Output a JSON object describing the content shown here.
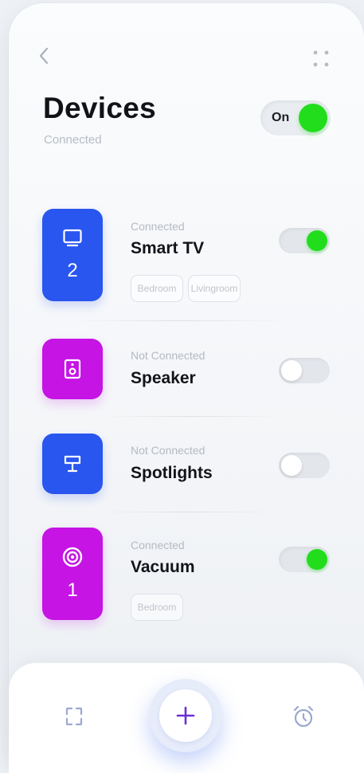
{
  "header": {
    "back_icon": "chevron-left-icon",
    "menu_icon": "dots-grid-icon",
    "title": "Devices",
    "subtitle": "Connected",
    "master_toggle": {
      "label": "On",
      "state": "on"
    }
  },
  "devices": [
    {
      "name": "Smart TV",
      "status": "Connected",
      "icon": "tv-icon",
      "tile_color": "#2956ef",
      "count": "2",
      "tags": [
        "Bedroom",
        "Livingroom"
      ],
      "enabled": true
    },
    {
      "name": "Speaker",
      "status": "Not Connected",
      "icon": "speaker-icon",
      "tile_color": "#c514e4",
      "count": "",
      "tags": [],
      "enabled": false
    },
    {
      "name": "Spotlights",
      "status": "Not Connected",
      "icon": "lamp-icon",
      "tile_color": "#2956ef",
      "count": "",
      "tags": [],
      "enabled": false
    },
    {
      "name": "Vacuum",
      "status": "Connected",
      "icon": "vacuum-target-icon",
      "tile_color": "#c514e4",
      "count": "1",
      "tags": [
        "Bedroom"
      ],
      "enabled": true
    }
  ],
  "bottom_nav": {
    "left_icon": "scan-frame-icon",
    "center_icon": "plus-icon",
    "right_icon": "alarm-clock-icon"
  },
  "colors": {
    "accent_green": "#22dd1c",
    "accent_blue": "#2956ef",
    "accent_purple": "#c514e4",
    "plus_color": "#6a2fd6"
  }
}
